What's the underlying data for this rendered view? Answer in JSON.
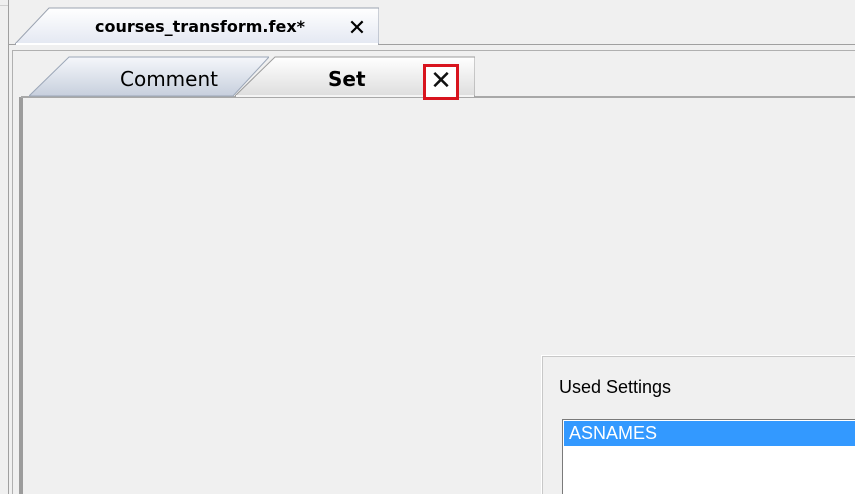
{
  "document_tab": {
    "title": "courses_transform.fex*",
    "close_glyph": "✕"
  },
  "editor_tabs": [
    {
      "label": "Comment",
      "active": false
    },
    {
      "label": "Set",
      "active": true,
      "close_glyph": "✕"
    }
  ],
  "used_settings": {
    "title": "Used Settings",
    "items": [
      {
        "label": "ASNAMES",
        "selected": true
      }
    ]
  },
  "colors": {
    "window_background": "#f0f0f0",
    "selection_background": "#3399ff",
    "highlight_border": "#d8141e"
  }
}
